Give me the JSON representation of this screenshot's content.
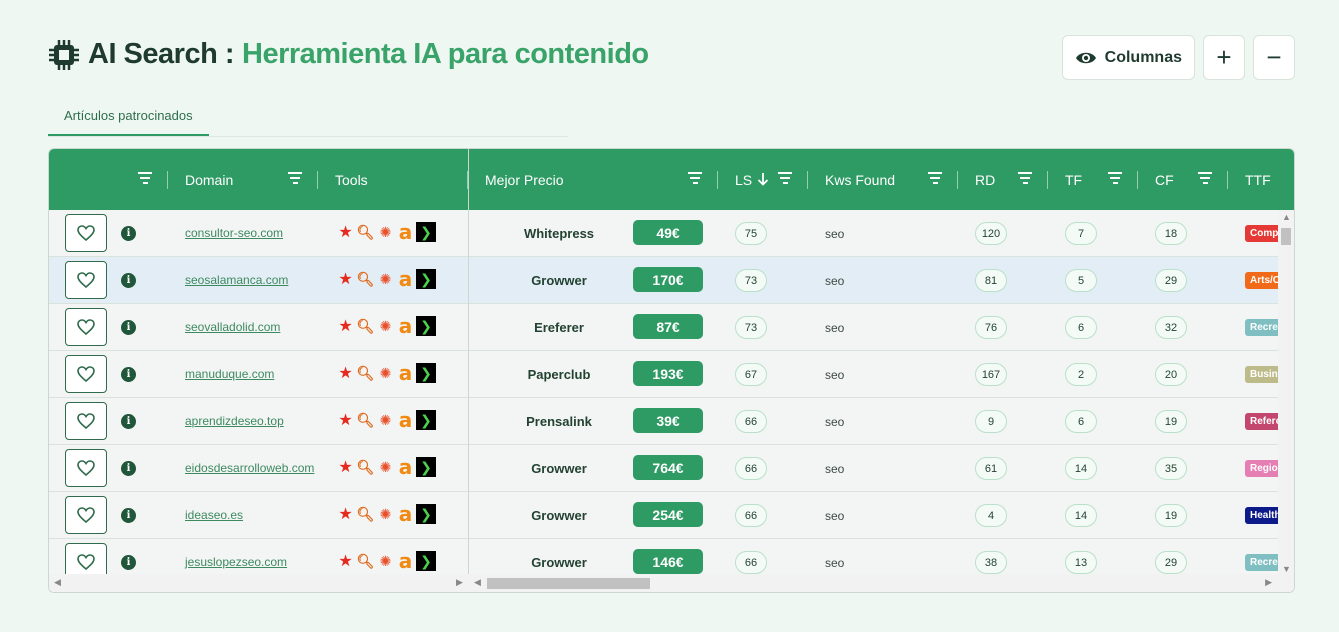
{
  "header": {
    "title_main": "AI Search :",
    "title_sub": "Herramienta IA para contenido",
    "columns_button": "Columnas",
    "add_label": "+",
    "remove_label": "−"
  },
  "tabs": [
    {
      "label": "Artículos patrocinados"
    }
  ],
  "table": {
    "columns": {
      "domain": "Domain",
      "tools": "Tools",
      "price": "Mejor Precio",
      "ls": "LS",
      "kws": "Kws Found",
      "rd": "RD",
      "tf": "TF",
      "cf": "CF",
      "ttf": "TTF"
    },
    "sort": {
      "column": "LS",
      "direction": "descending"
    },
    "rows": [
      {
        "domain": "consultor-seo.com",
        "provider": "Whitepress",
        "price": "49€",
        "ls": "75",
        "kws": "seo",
        "rd": "120",
        "tf": "7",
        "cf": "18",
        "ttf": "Comp",
        "ttf_color": "#e53935"
      },
      {
        "domain": "seosalamanca.com",
        "provider": "Growwer",
        "price": "170€",
        "ls": "73",
        "kws": "seo",
        "rd": "81",
        "tf": "5",
        "cf": "29",
        "ttf": "Arts/C",
        "ttf_color": "#f06a1a"
      },
      {
        "domain": "seovalladolid.com",
        "provider": "Ereferer",
        "price": "87€",
        "ls": "73",
        "kws": "seo",
        "rd": "76",
        "tf": "6",
        "cf": "32",
        "ttf": "Recrea",
        "ttf_color": "#7fbfc2"
      },
      {
        "domain": "manuduque.com",
        "provider": "Paperclub",
        "price": "193€",
        "ls": "67",
        "kws": "seo",
        "rd": "167",
        "tf": "2",
        "cf": "20",
        "ttf": "Busine",
        "ttf_color": "#bdbb8a"
      },
      {
        "domain": "aprendizdeseo.top",
        "provider": "Prensalink",
        "price": "39€",
        "ls": "66",
        "kws": "seo",
        "rd": "9",
        "tf": "6",
        "cf": "19",
        "ttf": "Refere",
        "ttf_color": "#c2466e"
      },
      {
        "domain": "eidosdesarrolloweb.com",
        "provider": "Growwer",
        "price": "764€",
        "ls": "66",
        "kws": "seo",
        "rd": "61",
        "tf": "14",
        "cf": "35",
        "ttf": "Region",
        "ttf_color": "#e57eb3"
      },
      {
        "domain": "ideaseo.es",
        "provider": "Growwer",
        "price": "254€",
        "ls": "66",
        "kws": "seo",
        "rd": "4",
        "tf": "14",
        "cf": "19",
        "ttf": "Health",
        "ttf_color": "#0d1a8a"
      },
      {
        "domain": "jesuslopezseo.com",
        "provider": "Growwer",
        "price": "146€",
        "ls": "66",
        "kws": "seo",
        "rd": "38",
        "tf": "13",
        "cf": "29",
        "ttf": "Recrea",
        "ttf_color": "#7fbfc2"
      }
    ]
  }
}
